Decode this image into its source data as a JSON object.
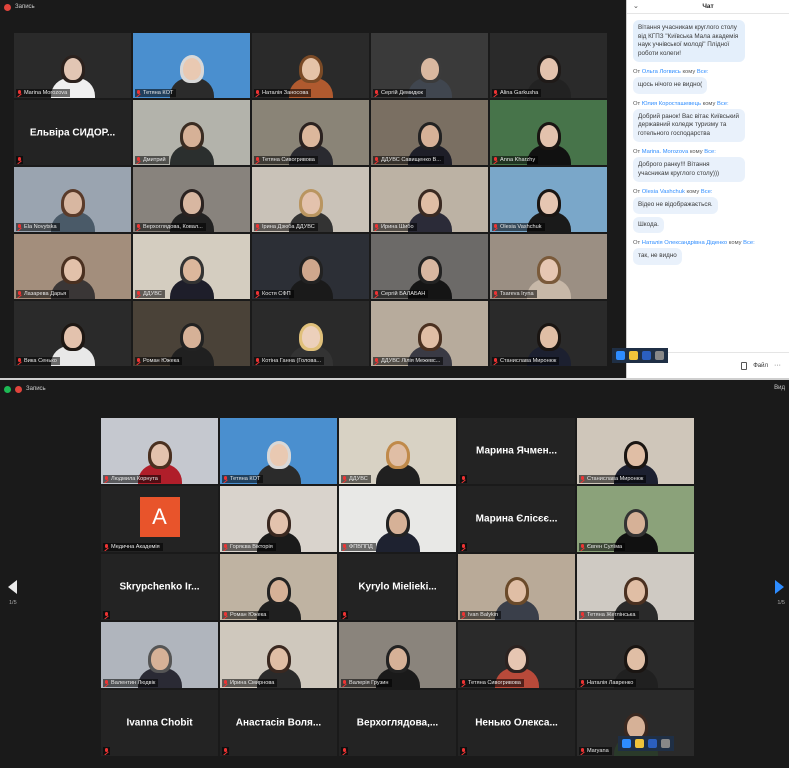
{
  "top": {
    "recording": "Запись",
    "tiles": [
      {
        "name": "Marina Morozova",
        "bg": "#2a2a2a",
        "person": {
          "skin": "#e2c6b4",
          "hair": "#2b211d",
          "body": "#efefef"
        }
      },
      {
        "name": "Тетяна КОТ",
        "bg": "#4a8fcf",
        "active": false,
        "person": {
          "skin": "#e9c9b2",
          "hair": "#d8d8d8",
          "body": "#2b2b2b"
        }
      },
      {
        "name": "Наталія Заносова",
        "bg": "#2a2a2a",
        "person": {
          "skin": "#e5c3a8",
          "hair": "#7a4a26",
          "body": "#b05a2f"
        }
      },
      {
        "name": "Сергій Демидюк",
        "bg": "#3a3a3a",
        "person": {
          "skin": "#d9b8a0",
          "hair": "#3b3b3b",
          "body": "#40464f"
        }
      },
      {
        "name": "Alina Garkusha",
        "bg": "#2a2a2a",
        "person": {
          "skin": "#e3c2ad",
          "hair": "#1f1a18",
          "body": "#222"
        }
      },
      {
        "name": "",
        "big": "Ельвіра СИДОР...",
        "bg": "#232323"
      },
      {
        "name": "Дмитрий",
        "bg": "#b3b3ab",
        "person": {
          "skin": "#d6b197",
          "hair": "#3a2c22",
          "body": "#2b2f2e"
        }
      },
      {
        "name": "Тетяна Сивогривова",
        "bg": "#8a8477",
        "person": {
          "skin": "#dcb79c",
          "hair": "#2b2220",
          "body": "#2a2a30"
        }
      },
      {
        "name": "ДДУВС Савищенко В...",
        "bg": "#7a6f62",
        "person": {
          "skin": "#d6b197",
          "hair": "#222",
          "body": "#1e1e28"
        }
      },
      {
        "name": "Anna Kharzhy",
        "bg": "#47744a",
        "person": {
          "skin": "#e3c2ad",
          "hair": "#1a1512",
          "body": "#111"
        }
      },
      {
        "name": "Ela Novytska",
        "bg": "#9aa4b0",
        "person": {
          "skin": "#d8b7a1",
          "hair": "#5a3b2a",
          "body": "#4a5a68"
        }
      },
      {
        "name": "Верхоглядова, Ковал...",
        "bg": "#88837d",
        "person": {
          "skin": "#d8b7a1",
          "hair": "#2a2220",
          "body": "#222"
        }
      },
      {
        "name": "Ірина Дзюба ДДУВС",
        "bg": "#c9c2b8",
        "person": {
          "skin": "#e3c2ad",
          "hair": "#b99560",
          "body": "#333"
        }
      },
      {
        "name": "Ирина Шибо",
        "bg": "#bcb2a4",
        "person": {
          "skin": "#e0bea5",
          "hair": "#3a2a22",
          "body": "#2b2b38"
        }
      },
      {
        "name": "Olesia Vashchuk",
        "bg": "#7aa7c9",
        "person": {
          "skin": "#e6c6b2",
          "hair": "#1a1512",
          "body": "#1a1a1a"
        }
      },
      {
        "name": "Лазарева Дарья",
        "bg": "#a38e7c",
        "person": {
          "skin": "#e2c1aa",
          "hair": "#4a3020",
          "body": "#3a3636"
        }
      },
      {
        "name": "ДДУВС",
        "bg": "#d4cdc0",
        "active": true,
        "person": {
          "skin": "#dcb79c",
          "hair": "#333",
          "body": "#1e1e2a"
        }
      },
      {
        "name": "Костя СФП",
        "bg": "#2c2f36",
        "person": {
          "skin": "#cfa78d",
          "hair": "#222",
          "body": "#1a1a1a"
        }
      },
      {
        "name": "Сергій БАЛАБАН",
        "bg": "#6c6a68",
        "person": {
          "skin": "#d8b7a1",
          "hair": "#222",
          "body": "#151515"
        }
      },
      {
        "name": "Tsareva Iryna",
        "bg": "#9b8f83",
        "person": {
          "skin": "#e6c6b2",
          "hair": "#7a5a3a",
          "body": "#c7b8a8"
        }
      },
      {
        "name": "Вика Сенько",
        "bg": "#2a2a2a",
        "person": {
          "skin": "#e3c2ad",
          "hair": "#1d1713",
          "body": "#e8e8e8"
        }
      },
      {
        "name": "Роман Южека",
        "bg": "#4a4238",
        "person": {
          "skin": "#d6b197",
          "hair": "#222",
          "body": "#202020"
        }
      },
      {
        "name": "Котіна Ганна (Голова...",
        "bg": "#2a2a2a",
        "person": {
          "skin": "#ecd0bb",
          "hair": "#e0c07a",
          "body": "#333"
        }
      },
      {
        "name": "ДДУВС Лілія Межевс...",
        "bg": "#b7ab9c",
        "person": {
          "skin": "#e0bea5",
          "hair": "#4a3020",
          "body": "#3a3a44"
        }
      },
      {
        "name": "Станислава Миронюк",
        "bg": "#2a2a2a",
        "person": {
          "skin": "#e0bea5",
          "hair": "#1a1512",
          "body": "#1c2030"
        }
      }
    ]
  },
  "chat": {
    "title": "Чат",
    "messages": [
      {
        "meta_prefix": "",
        "from": "",
        "to": "",
        "texts": [
          "Вітання учасникам круглого столу від КГПЗ \"Київська Мала академія наук учнівської молоді\" Плідної роботи колеги!"
        ]
      },
      {
        "meta_prefix": "От",
        "from": "Ольга Логвись",
        "to_prefix": "кому",
        "to": "Все:",
        "texts": [
          "щось нічого не видно("
        ]
      },
      {
        "meta_prefix": "От",
        "from": "Юлия Коросташевець",
        "to_prefix": "кому",
        "to": "Все:",
        "texts": [
          "Добрий ранок! Вас вітає Київський державний коледж туризму та готельного господарства"
        ]
      },
      {
        "meta_prefix": "От",
        "from": "Marina. Morozova",
        "to_prefix": "кому",
        "to": "Все:",
        "texts": [
          "Доброго ранку!!! Вітання учасникам круглого столу)))"
        ]
      },
      {
        "meta_prefix": "От",
        "from": "Olesia Vashchuk",
        "to_prefix": "кому",
        "to": "Все:",
        "texts": [
          "Відео не відображається.",
          "Шкода."
        ]
      },
      {
        "meta_prefix": "От",
        "from": "Наталія Олександрівна Діденко",
        "to_prefix": "кому",
        "to": "Все:",
        "texts": [
          "так, не видно"
        ]
      }
    ],
    "file_label": "Файл",
    "more_label": "···"
  },
  "bottom": {
    "recording": "Запись",
    "view_label": "Вид",
    "page_left": "1/5",
    "page_right": "1/5",
    "tiles": [
      {
        "name": "Людмила Корнута",
        "bg": "#c5c8cf",
        "person": {
          "skin": "#e3c2ad",
          "hair": "#4a3020",
          "body": "#b01e2a"
        }
      },
      {
        "name": "Тетяна КОТ",
        "bg": "#4a8fcf",
        "person": {
          "skin": "#e9c9b2",
          "hair": "#d8d8d8",
          "body": "#2b2b2b"
        }
      },
      {
        "name": "ДДУВС",
        "bg": "#d8d2c4",
        "person": {
          "skin": "#e0bea5",
          "hair": "#c08a4a",
          "body": "#202020"
        }
      },
      {
        "name": "",
        "big": "Марина Ячмен...",
        "bg": "#232323"
      },
      {
        "name": "Станислава Миронюк",
        "bg": "#cfc6ba",
        "active": true,
        "person": {
          "skin": "#e0bea5",
          "hair": "#1a1512",
          "body": "#1c2030"
        }
      },
      {
        "name": "Медична Академія",
        "bg": "#232323",
        "avatar": "A"
      },
      {
        "name": "Горяєва Вікторія",
        "bg": "#d9d3cc",
        "person": {
          "skin": "#e3c2ad",
          "hair": "#3a2820",
          "body": "#1a1a1a"
        }
      },
      {
        "name": "ФПВППД",
        "bg": "#e8e8e6",
        "person": {
          "skin": "#d6b197",
          "hair": "#222",
          "body": "#1e2230"
        }
      },
      {
        "name": "",
        "big": "Марина Єлісєє...",
        "bg": "#232323"
      },
      {
        "name": "Євген Сулїма",
        "bg": "#8ba27a",
        "person": {
          "skin": "#d6b197",
          "hair": "#333",
          "body": "#111"
        }
      },
      {
        "name": "",
        "big": "Skrypchenko Ir...",
        "bg": "#232323"
      },
      {
        "name": "Роман Южека",
        "bg": "#bfb3a2",
        "person": {
          "skin": "#d6b197",
          "hair": "#222",
          "body": "#202020"
        }
      },
      {
        "name": "",
        "big": "Kyrylo Mielieki...",
        "bg": "#232323"
      },
      {
        "name": "Ivan Balykin",
        "bg": "#b9aa98",
        "person": {
          "skin": "#e0bea5",
          "hair": "#6a4a2a",
          "body": "#3a3f4a"
        }
      },
      {
        "name": "Тетяна Жеглінська",
        "bg": "#cfcac3",
        "person": {
          "skin": "#e0bea5",
          "hair": "#4a3020",
          "body": "#2a2a2a"
        }
      },
      {
        "name": "Валентин Людвік",
        "bg": "#b0b5bd",
        "person": {
          "skin": "#d6b197",
          "hair": "#555",
          "body": "#2a2a34"
        }
      },
      {
        "name": "Ирина Смирнова",
        "bg": "#cfc8bd",
        "person": {
          "skin": "#e0bea5",
          "hair": "#3a2820",
          "body": "#2a2a2a"
        }
      },
      {
        "name": "Валерія Грузин",
        "bg": "#8a847c",
        "person": {
          "skin": "#d6b197",
          "hair": "#222",
          "body": "#1a1a1a"
        }
      },
      {
        "name": "Тетяна Сивогривова",
        "bg": "#2a2a2a",
        "person": {
          "skin": "#e6c6b2",
          "hair": "#2b2220",
          "body": "#b84a3a"
        }
      },
      {
        "name": "Наталія Лавренко",
        "bg": "#2a2a2a",
        "person": {
          "skin": "#e0bea5",
          "hair": "#1a1512",
          "body": "#202020"
        }
      },
      {
        "name": "",
        "big": "Ivanna Chobit",
        "bg": "#232323"
      },
      {
        "name": "",
        "big": "Анастасія Воля...",
        "bg": "#232323"
      },
      {
        "name": "",
        "big": "Верхоглядова,...",
        "bg": "#232323"
      },
      {
        "name": "",
        "big": "Ненько Олекса...",
        "bg": "#232323"
      },
      {
        "name": "Maryana",
        "bg": "#2a2a2a",
        "person": {
          "skin": "#d6b197",
          "hair": "#3a2820",
          "body": "#2a3a2a"
        }
      }
    ]
  },
  "colors": {
    "active_border": "#c7e36e",
    "accent": "#2d8cff",
    "avatar_bg": "#e8542b"
  }
}
